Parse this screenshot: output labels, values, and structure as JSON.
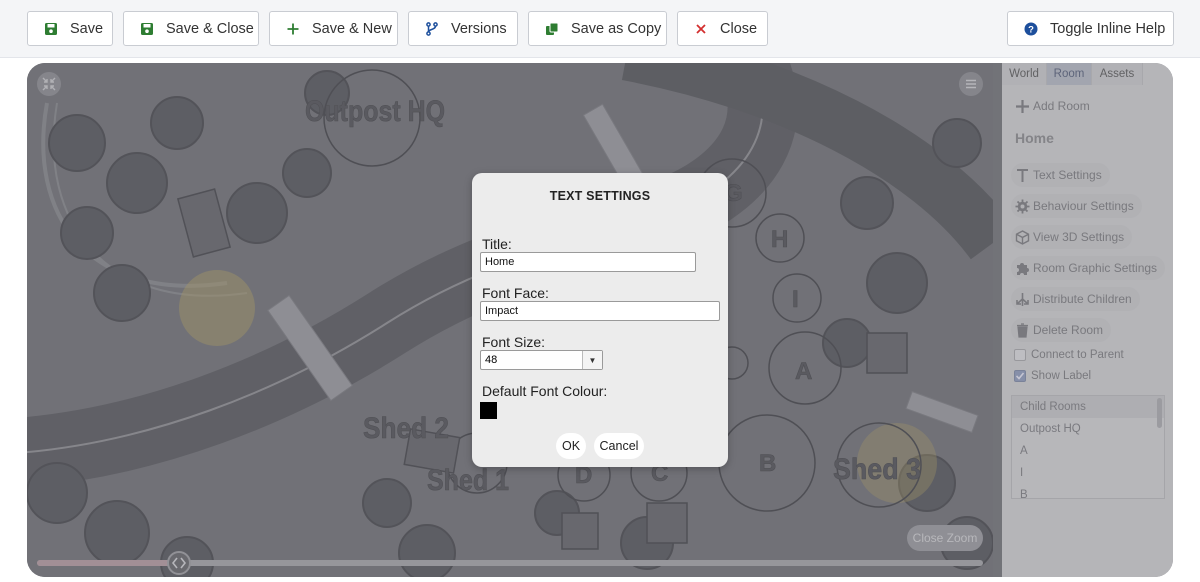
{
  "toolbar": {
    "save": "Save",
    "save_close": "Save & Close",
    "save_new": "Save & New",
    "versions": "Versions",
    "save_copy": "Save as Copy",
    "close": "Close",
    "help": "Toggle Inline Help",
    "colors": {
      "save_icon": "#2e7d32",
      "close_icon": "#d32f2f",
      "help_icon": "#1d4f9c",
      "versions_icon": "#1d4f9c"
    }
  },
  "map": {
    "labels": [
      "Outpost HQ",
      "Shed 2",
      "Shed 1",
      "Shed 3",
      "A",
      "B",
      "C",
      "D",
      "G",
      "H",
      "I"
    ]
  },
  "panel": {
    "tabs": [
      "World",
      "Room",
      "Assets"
    ],
    "active_tab": "Room",
    "add_room": "Add Room",
    "room_name": "Home",
    "items": [
      "Text Settings",
      "Behaviour Settings",
      "View 3D Settings",
      "Room Graphic Settings",
      "Distribute Children",
      "Delete Room"
    ],
    "connect_parent": "Connect to Parent",
    "show_label": "Show Label",
    "show_label_checked": true,
    "connect_parent_checked": false,
    "child_rooms_header": "Child Rooms",
    "child_rooms": [
      "Outpost HQ",
      "A",
      "I",
      "B"
    ]
  },
  "dialog": {
    "title": "TEXT SETTINGS",
    "title_label": "Title:",
    "title_value": "Home",
    "font_face_label": "Font Face:",
    "font_face_value": "Impact",
    "font_size_label": "Font Size:",
    "font_size_value": "48",
    "font_colour_label": "Default Font Colour:",
    "font_colour": "#000000",
    "ok": "OK",
    "cancel": "Cancel"
  },
  "zoom": {
    "close_zoom": "Close Zoom",
    "slider_value": 0.15
  }
}
